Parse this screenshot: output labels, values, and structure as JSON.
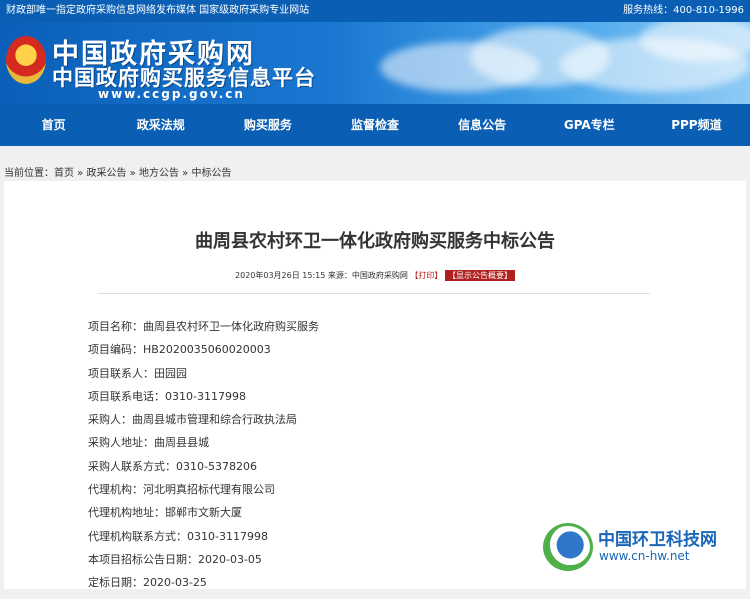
{
  "topbar": {
    "left_text": "财政部唯一指定政府采购信息网络发布媒体  国家级政府采购专业网站",
    "hotline": "服务热线：400-810-1996"
  },
  "banner": {
    "title": "中国政府采购网",
    "subtitle": "中国政府购买服务信息平台",
    "url": "www.ccgp.gov.cn"
  },
  "nav": {
    "items": [
      "首页",
      "政采法规",
      "购买服务",
      "监督检查",
      "信息公告",
      "GPA专栏",
      "PPP频道"
    ]
  },
  "breadcrumb": {
    "prefix": "当前位置：",
    "items": [
      "首页",
      "政采公告",
      "地方公告",
      "中标公告"
    ],
    "separator": " » "
  },
  "article": {
    "title": "曲周县农村环卫一体化政府购买服务中标公告",
    "meta_text": "2020年03月26日 15:15 来源：中国政府采购网",
    "print_label": "【打印】",
    "summary_label": "【显示公告概要】",
    "fields": [
      "项目名称：曲周县农村环卫一体化政府购买服务",
      "项目编码：HB2020035060020003",
      "项目联系人：田园园",
      "项目联系电话：0310-3117998",
      "采购人：曲周县城市管理和综合行政执法局",
      "采购人地址：曲周县县城",
      "采购人联系方式：0310-5378206",
      "代理机构：河北明真招标代理有限公司",
      "代理机构地址：邯郸市文新大厦",
      "代理机构联系方式：0310-3117998",
      "本项目招标公告日期：2020-03-05",
      "定标日期：2020-03-25"
    ]
  },
  "watermark": {
    "name": "中国环卫科技网",
    "url": "www.cn-hw.net"
  }
}
